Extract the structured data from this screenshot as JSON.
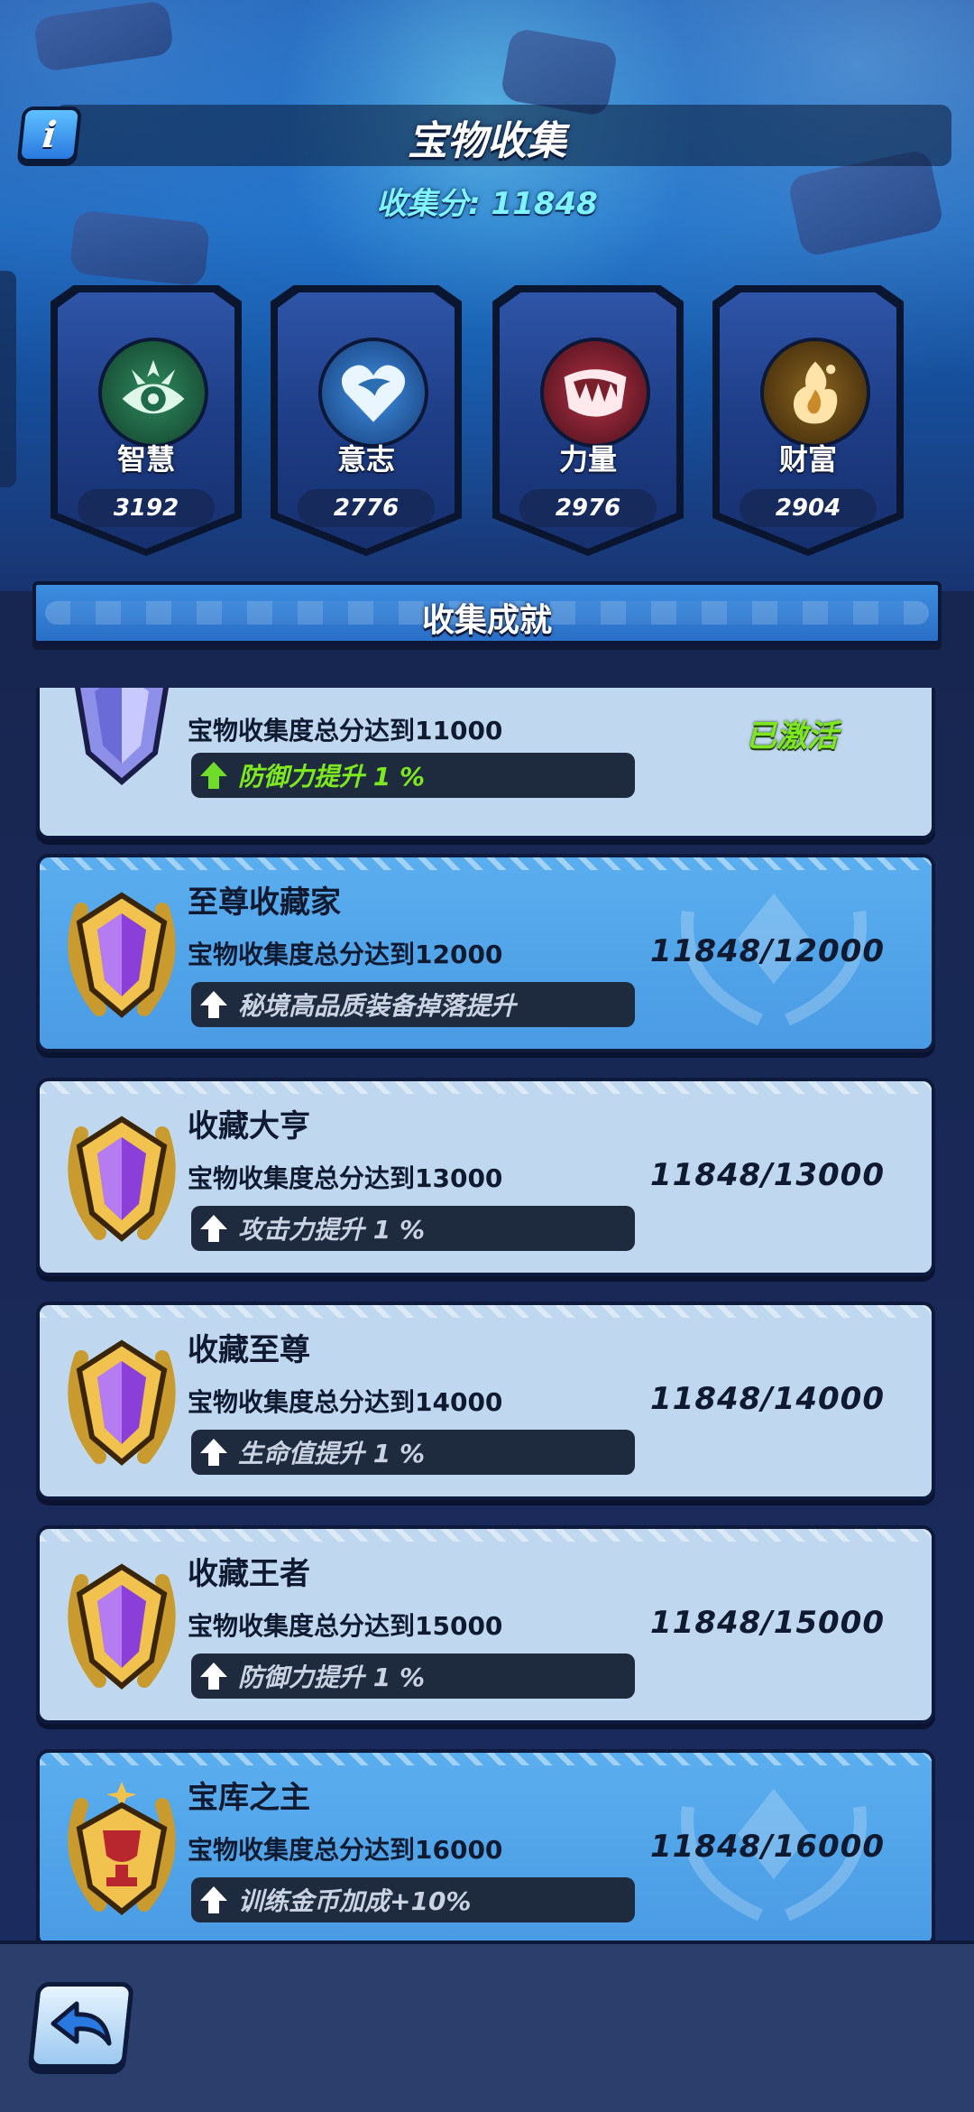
{
  "header": {
    "info_label": "i",
    "title": "宝物收集",
    "score_text": "收集分: 11848"
  },
  "attributes": [
    {
      "name": "智慧",
      "value": "3192",
      "icon": "eye-icon",
      "color": "#1f6a4a"
    },
    {
      "name": "意志",
      "value": "2776",
      "icon": "heart-icon",
      "color": "#2a6fb0"
    },
    {
      "name": "力量",
      "value": "2976",
      "icon": "fangs-icon",
      "color": "#7a1f2c"
    },
    {
      "name": "财富",
      "value": "2904",
      "icon": "flame-icon",
      "color": "#6a4a1a"
    }
  ],
  "section": {
    "title": "收集成就"
  },
  "achievements": [
    {
      "name": "",
      "condition": "宝物收集度总分达到11000",
      "reward": "防御力提升 1 %",
      "status": "已激活",
      "progress": "",
      "medal": "silver-gem-medal-icon",
      "highlight": false,
      "reward_active": true
    },
    {
      "name": "至尊收藏家",
      "condition": "宝物收集度总分达到12000",
      "reward": "秘境高品质装备掉落提升",
      "status": "",
      "progress": "11848/12000",
      "medal": "gold-gem-medal-icon",
      "highlight": true,
      "reward_active": false
    },
    {
      "name": "收藏大亨",
      "condition": "宝物收集度总分达到13000",
      "reward": "攻击力提升 1 %",
      "status": "",
      "progress": "11848/13000",
      "medal": "gold-gem-medal-icon",
      "highlight": false,
      "reward_active": false
    },
    {
      "name": "收藏至尊",
      "condition": "宝物收集度总分达到14000",
      "reward": "生命值提升 1 %",
      "status": "",
      "progress": "11848/14000",
      "medal": "gold-gem-medal-icon",
      "highlight": false,
      "reward_active": false
    },
    {
      "name": "收藏王者",
      "condition": "宝物收集度总分达到15000",
      "reward": "防御力提升 1 %",
      "status": "",
      "progress": "11848/15000",
      "medal": "gold-gem-medal-icon",
      "highlight": false,
      "reward_active": false
    },
    {
      "name": "宝库之主",
      "condition": "宝物收集度总分达到16000",
      "reward": "训练金币加成+10%",
      "status": "",
      "progress": "11848/16000",
      "medal": "gold-trophy-medal-icon",
      "highlight": true,
      "reward_active": false
    }
  ],
  "footer": {
    "back_icon": "back-arrow-icon"
  }
}
